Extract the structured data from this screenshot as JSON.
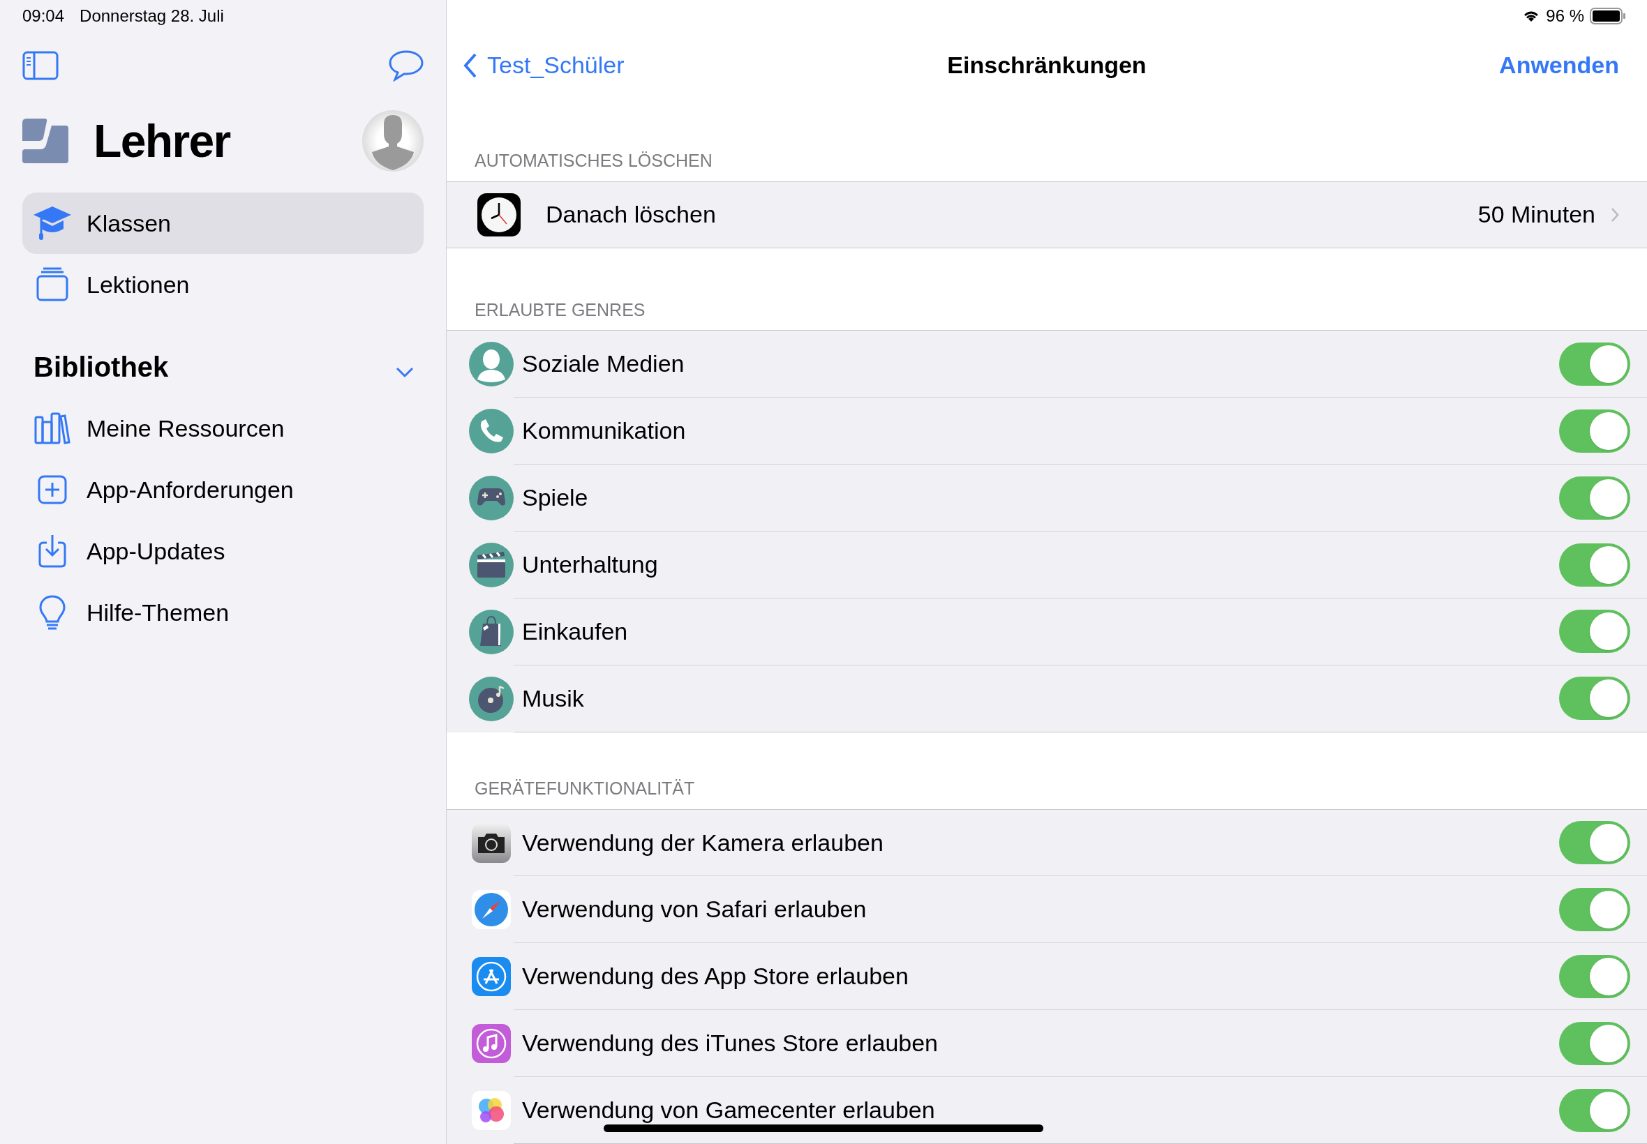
{
  "status_bar": {
    "time": "09:04",
    "date": "Donnerstag 28. Juli",
    "battery": "96 %"
  },
  "sidebar": {
    "title": "Lehrer",
    "items": [
      {
        "label": "Klassen",
        "selected": true
      },
      {
        "label": "Lektionen",
        "selected": false
      }
    ],
    "section": {
      "title": "Bibliothek",
      "expanded": true,
      "items": [
        {
          "label": "Meine Ressourcen",
          "selected": false
        },
        {
          "label": "App-Anforderungen",
          "selected": false
        },
        {
          "label": "App-Updates",
          "selected": false
        },
        {
          "label": "Hilfe-Themen",
          "selected": false
        }
      ]
    }
  },
  "nav_bar": {
    "back": "Test_Schüler",
    "title": "Einschränkungen",
    "action": "Anwenden"
  },
  "auto_delete": {
    "header": "AUTOMATISCHES LÖSCHEN",
    "label": "Danach löschen",
    "value": "50 Minuten"
  },
  "genres": {
    "header": "ERLAUBTE GENRES",
    "items": [
      {
        "label": "Soziale Medien",
        "on": true
      },
      {
        "label": "Kommunikation",
        "on": true
      },
      {
        "label": "Spiele",
        "on": true
      },
      {
        "label": "Unterhaltung",
        "on": true
      },
      {
        "label": "Einkaufen",
        "on": true
      },
      {
        "label": "Musik",
        "on": true
      }
    ]
  },
  "device": {
    "header": "GERÄTEFUNKTIONALITÄT",
    "items": [
      {
        "label": "Verwendung der Kamera erlauben",
        "on": true
      },
      {
        "label": "Verwendung von Safari erlauben",
        "on": true
      },
      {
        "label": "Verwendung des App Store erlauben",
        "on": true
      },
      {
        "label": "Verwendung des iTunes Store erlauben",
        "on": true
      },
      {
        "label": "Verwendung von Gamecenter erlauben",
        "on": true
      }
    ]
  }
}
